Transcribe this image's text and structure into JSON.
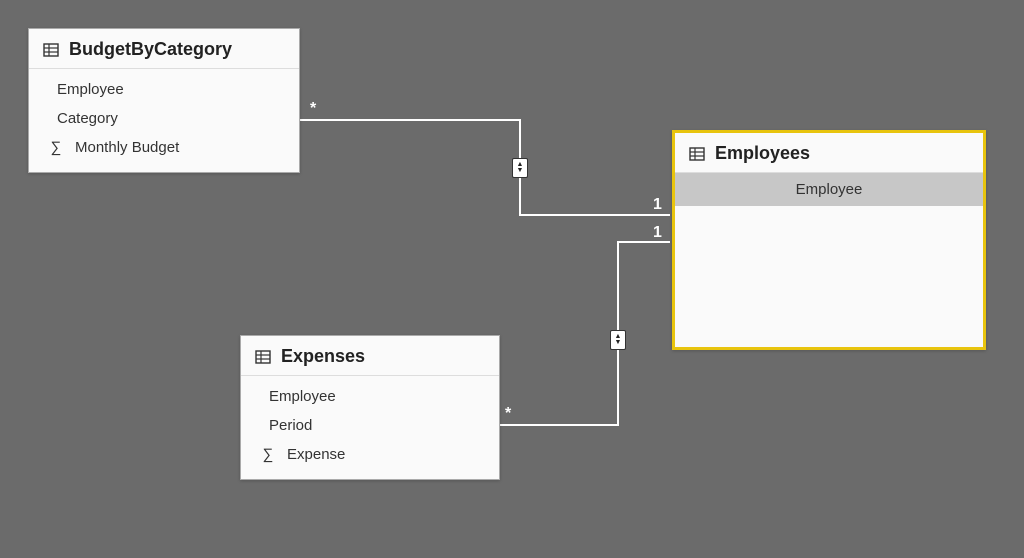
{
  "tables": {
    "budget": {
      "title": "BudgetByCategory",
      "fields": [
        {
          "label": "Employee",
          "icon": ""
        },
        {
          "label": "Category",
          "icon": ""
        },
        {
          "label": "Monthly Budget",
          "icon": "sigma"
        }
      ]
    },
    "expenses": {
      "title": "Expenses",
      "fields": [
        {
          "label": "Employee",
          "icon": ""
        },
        {
          "label": "Period",
          "icon": ""
        },
        {
          "label": "Expense",
          "icon": "sigma"
        }
      ]
    },
    "employees": {
      "title": "Employees",
      "fields": [
        {
          "label": "Employee",
          "icon": "",
          "highlight": true
        }
      ]
    }
  },
  "relationships": [
    {
      "from": "budget",
      "to": "employees",
      "from_cardinality": "*",
      "to_cardinality": "1"
    },
    {
      "from": "expenses",
      "to": "employees",
      "from_cardinality": "*",
      "to_cardinality": "1"
    }
  ]
}
